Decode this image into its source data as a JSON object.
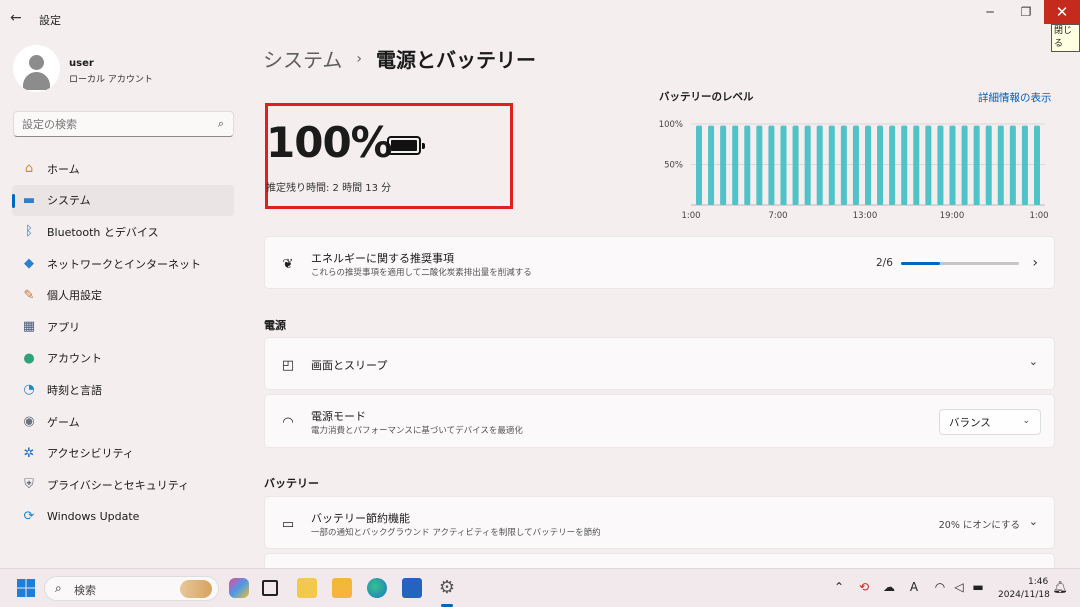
{
  "window": {
    "back_glyph": "←",
    "title": "設定",
    "minimize_glyph": "─",
    "maximize_glyph": "❐",
    "close_glyph": "✕",
    "close_tooltip": "閉じる"
  },
  "user": {
    "name": "user",
    "account_type": "ローカル アカウント"
  },
  "search": {
    "placeholder": "設定の検索",
    "icon": "search-icon"
  },
  "sidebar": {
    "items": [
      {
        "label": "ホーム",
        "icon": "home-icon",
        "glyph": "⌂",
        "color": "#d08a2e"
      },
      {
        "label": "システム",
        "icon": "system-icon",
        "glyph": "▬",
        "color": "#2d7fd1",
        "active": true
      },
      {
        "label": "Bluetooth とデバイス",
        "icon": "bluetooth-icon",
        "glyph": "ᛒ",
        "color": "#1f6fc9"
      },
      {
        "label": "ネットワークとインターネット",
        "icon": "wifi-icon",
        "glyph": "◆",
        "color": "#2d7fd1"
      },
      {
        "label": "個人用設定",
        "icon": "brush-icon",
        "glyph": "✎",
        "color": "#c0762c"
      },
      {
        "label": "アプリ",
        "icon": "apps-icon",
        "glyph": "▦",
        "color": "#4a5a78"
      },
      {
        "label": "アカウント",
        "icon": "account-icon",
        "glyph": "●",
        "color": "#2ea37a"
      },
      {
        "label": "時刻と言語",
        "icon": "globe-clock-icon",
        "glyph": "◔",
        "color": "#1d86c8"
      },
      {
        "label": "ゲーム",
        "icon": "gamepad-icon",
        "glyph": "◉",
        "color": "#6b7280"
      },
      {
        "label": "アクセシビリティ",
        "icon": "accessibility-icon",
        "glyph": "✲",
        "color": "#1f6fc9"
      },
      {
        "label": "プライバシーとセキュリティ",
        "icon": "shield-icon",
        "glyph": "⛨",
        "color": "#6b7280"
      },
      {
        "label": "Windows Update",
        "icon": "update-icon",
        "glyph": "⟳",
        "color": "#1d86c8"
      }
    ]
  },
  "breadcrumb": {
    "parent": "システム",
    "separator": "›",
    "current": "電源とバッテリー"
  },
  "battery": {
    "percent": "100%",
    "remaining": "推定残り時間: 2 時間 13 分"
  },
  "chart_data": {
    "type": "bar",
    "title": "バッテリーのレベル",
    "link": "詳細情報の表示",
    "y_ticks": [
      "100%",
      "50%"
    ],
    "x_ticks": [
      "1:00",
      "7:00",
      "13:00",
      "19:00",
      "1:00"
    ],
    "ylim": [
      0,
      100
    ],
    "bar_color": "#4fc3c8",
    "values": [
      98,
      98,
      98,
      98,
      98,
      98,
      98,
      98,
      98,
      98,
      98,
      98,
      98,
      98,
      98,
      98,
      98,
      98,
      98,
      98,
      98,
      98,
      98,
      98,
      98,
      98,
      98,
      98,
      98
    ],
    "grid": true
  },
  "energy": {
    "title": "エネルギーに関する推奨事項",
    "subtitle": "これらの推奨事項を適用して二酸化炭素排出量を削減する",
    "progress_label": "2/6",
    "progress_fraction": 0.333,
    "chevron": "›"
  },
  "power_section": {
    "heading": "電源",
    "screen_sleep": {
      "title": "画面とスリープ",
      "chevron": "⌄"
    },
    "power_mode": {
      "title": "電源モード",
      "subtitle": "電力消費とパフォーマンスに基づいてデバイスを最適化",
      "selected": "バランス",
      "chevron": "⌄"
    }
  },
  "battery_section": {
    "heading": "バッテリー",
    "saver": {
      "title": "バッテリー節約機能",
      "subtitle": "一部の通知とバックグラウンド アクティビティを制限してバッテリーを節約",
      "status": "20% にオンにする",
      "chevron": "⌄"
    }
  },
  "taskbar": {
    "search_placeholder": "検索",
    "clock_time": "1:46",
    "clock_date": "2024/11/18",
    "tray_chevron": "⌃",
    "ime": "A"
  },
  "colors": {
    "accent": "#0067c0",
    "close": "#c42b1c",
    "highlight": "#e02020"
  }
}
